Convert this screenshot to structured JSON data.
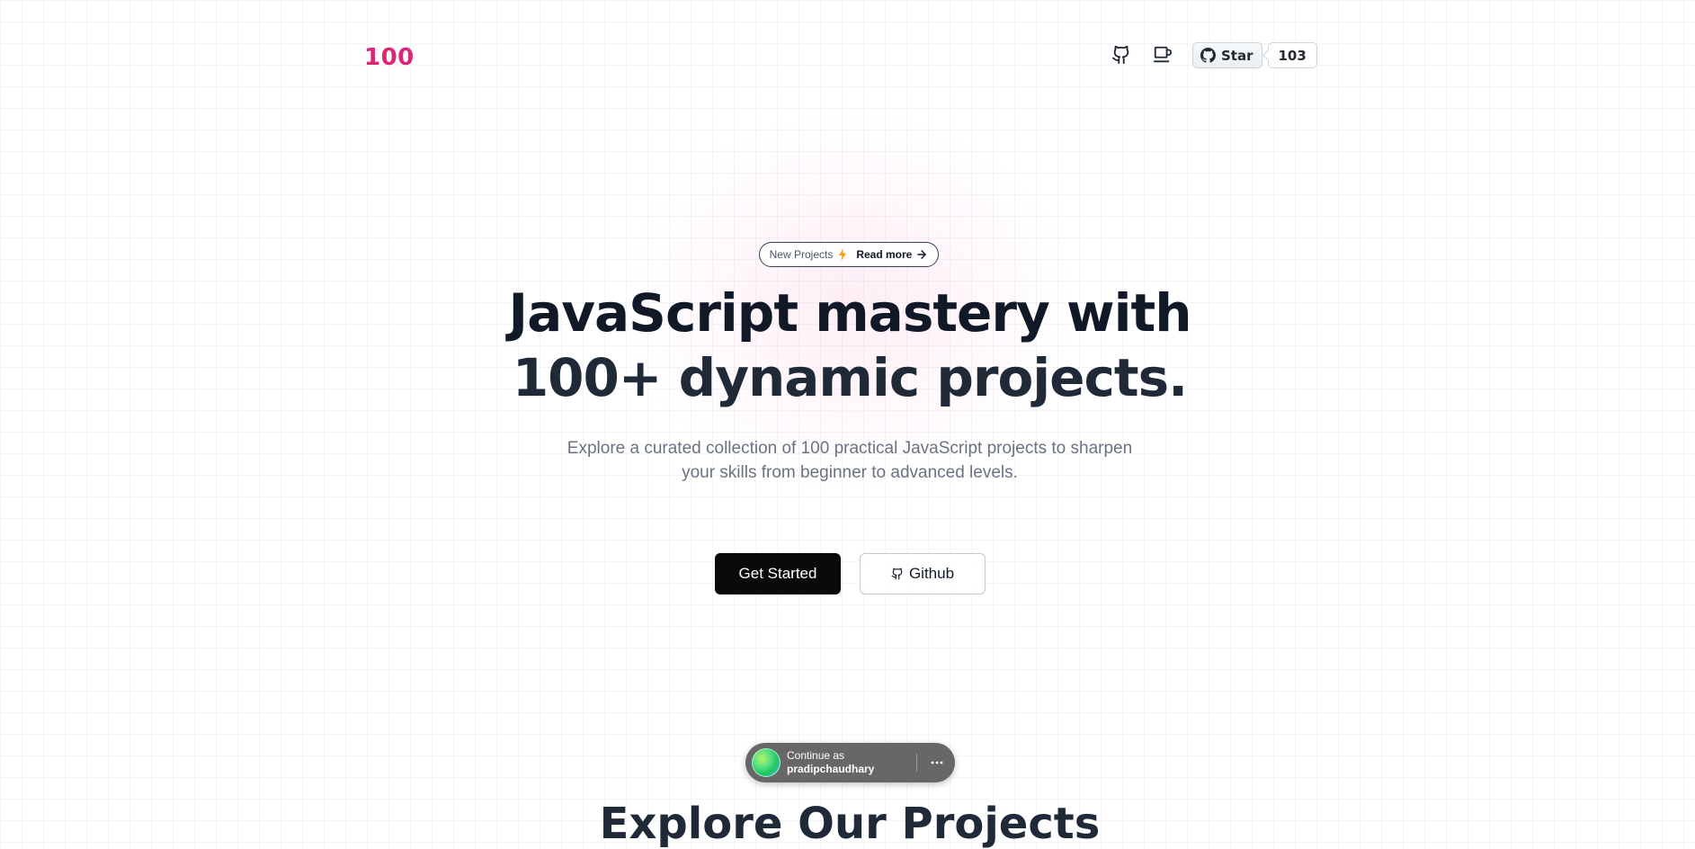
{
  "header": {
    "logo": "100",
    "github_star": {
      "label": "Star",
      "count": "103"
    }
  },
  "announcement": {
    "label": "New Projects",
    "link_label": "Read more"
  },
  "hero": {
    "title_line1": "JavaScript mastery with",
    "title_line2": "100+ dynamic projects.",
    "subtitle_line1": "Explore a curated collection of 100 practical JavaScript projects to sharpen",
    "subtitle_line2": "your skills from beginner to advanced levels.",
    "primary_button": "Get Started",
    "secondary_button": "Github"
  },
  "next_section": {
    "heading": "Explore Our Projects"
  },
  "sign_in_prompt": {
    "line1": "Continue as",
    "username": "pradipchaudhary"
  },
  "icons": {
    "nav": [
      "github-icon",
      "coffee-icon"
    ],
    "announcement": "lightning-icon",
    "arrow": "arrow-right-icon",
    "more": "more-horizontal-icon"
  },
  "colors": {
    "brand": "#db2777",
    "primary_button": "#0a0a0a",
    "toast_bg": "#676767"
  }
}
